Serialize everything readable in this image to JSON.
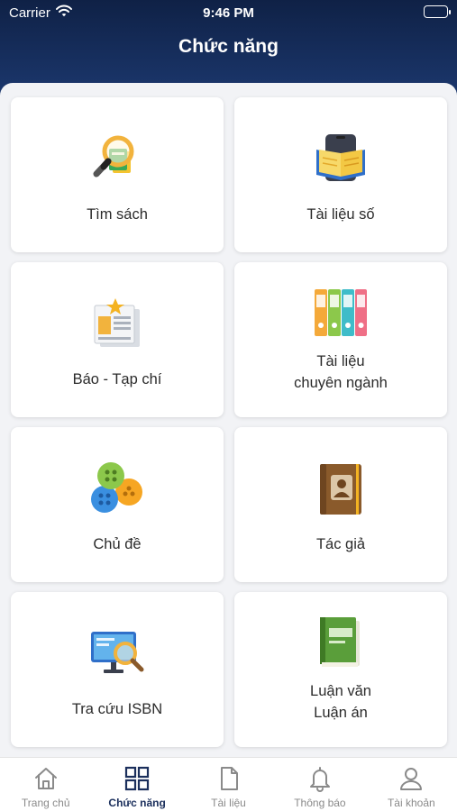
{
  "status_bar": {
    "carrier": "Carrier",
    "time": "9:46 PM"
  },
  "header": {
    "title": "Chức năng"
  },
  "grid": {
    "items": [
      {
        "label": "Tìm sách",
        "icon": "search-book-icon"
      },
      {
        "label": "Tài liệu số",
        "icon": "digital-document-icon"
      },
      {
        "label": "Báo - Tạp chí",
        "icon": "newspaper-icon"
      },
      {
        "label_line1": "Tài liệu",
        "label_line2": "chuyên ngành",
        "icon": "binders-icon"
      },
      {
        "label": "Chủ đề",
        "icon": "buttons-topic-icon"
      },
      {
        "label": "Tác giả",
        "icon": "author-book-icon"
      },
      {
        "label": "Tra cứu ISBN",
        "icon": "isbn-lookup-icon"
      },
      {
        "label_line1": "Luận văn",
        "label_line2": "Luận án",
        "icon": "thesis-book-icon"
      }
    ]
  },
  "tabbar": {
    "active_color": "#1b2f5c",
    "inactive_color": "#8a8a8a",
    "tabs": [
      {
        "label": "Trang chủ",
        "icon": "home-icon",
        "active": false
      },
      {
        "label": "Chức năng",
        "icon": "grid-icon",
        "active": true
      },
      {
        "label": "Tài liệu",
        "icon": "document-icon",
        "active": false
      },
      {
        "label": "Thông báo",
        "icon": "bell-icon",
        "active": false
      },
      {
        "label": "Tài khoản",
        "icon": "user-icon",
        "active": false
      }
    ]
  }
}
